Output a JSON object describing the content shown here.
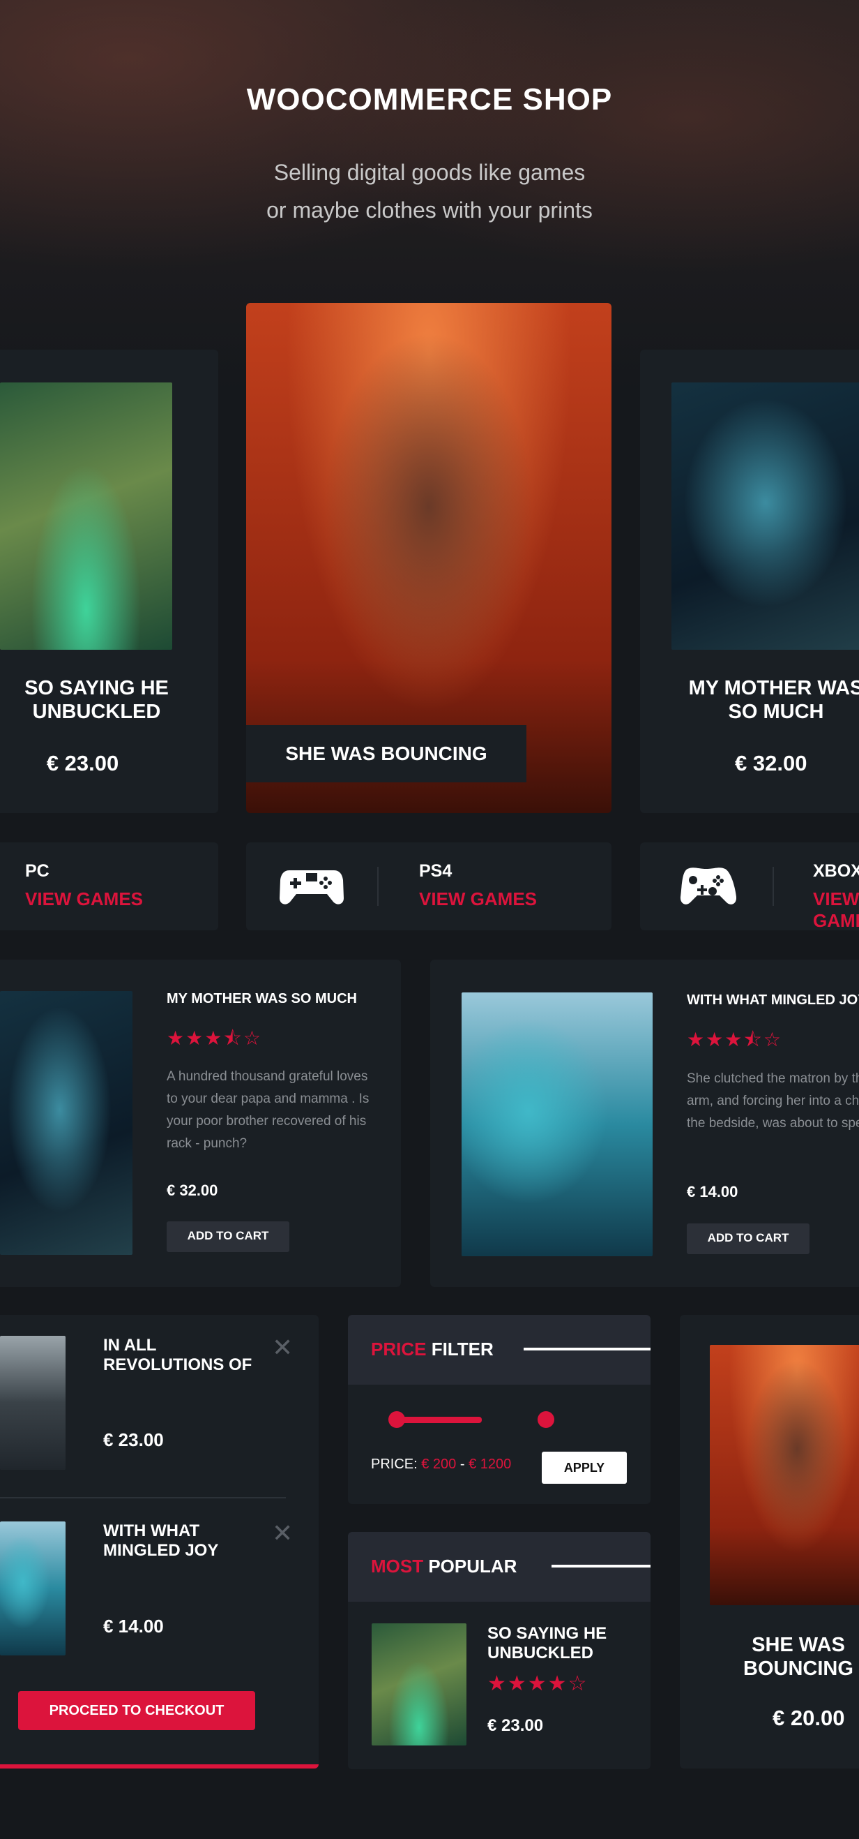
{
  "header": {
    "title": "WOOCOMMERCE SHOP",
    "subtitle_line1": "Selling digital goods like games",
    "subtitle_line2": "or maybe clothes with your prints"
  },
  "carousel": [
    {
      "title_line1": "SO SAYING HE",
      "title_line2": "UNBUCKLED",
      "price": "€ 23.00"
    },
    {
      "title": "SHE WAS BOUNCING"
    },
    {
      "title_line1": "MY MOTHER WAS",
      "title_line2": "SO MUCH",
      "price": "€ 32.00"
    }
  ],
  "platforms": [
    {
      "name": "PC",
      "link": "VIEW GAMES"
    },
    {
      "name": "PS4",
      "link": "VIEW GAMES",
      "icon": "gamepad-icon"
    },
    {
      "name": "XBOX",
      "link": "VIEW GAMES",
      "icon": "xbox-controller-icon"
    }
  ],
  "products": [
    {
      "title": "MY MOTHER WAS SO MUCH",
      "rating": 3.5,
      "stars": "★★★⯪☆",
      "description": "A hundred thousand grateful loves to your dear papa and mamma . Is your poor brother recovered of his rack - punch?",
      "price": "€ 32.00",
      "button": "ADD TO CART"
    },
    {
      "title": "WITH WHAT MINGLED JOY",
      "rating": 3.5,
      "stars": "★★★⯪☆",
      "description": "She clutched the matron by the arm, and forcing her into a chair by the bedside, was about to speak.",
      "price": "€ 14.00",
      "button": "ADD TO CART"
    }
  ],
  "cart": {
    "items": [
      {
        "title_line1": "IN ALL",
        "title_line2": "REVOLUTIONS OF",
        "price": "€ 23.00"
      },
      {
        "title_line1": "WITH WHAT",
        "title_line2": "MINGLED JOY",
        "price": "€ 14.00"
      }
    ],
    "remove": "✕",
    "checkout": "PROCEED TO CHECKOUT"
  },
  "price_filter": {
    "title_accent": "PRICE",
    "title_rest": "FILTER",
    "label": "PRICE:",
    "min": "€ 200",
    "dash": "-",
    "max": "€ 1200",
    "apply": "APPLY"
  },
  "most_popular": {
    "title_accent": "MOST",
    "title_rest": "POPULAR",
    "item": {
      "title_line1": "SO SAYING HE",
      "title_line2": "UNBUCKLED",
      "rating": 4,
      "stars": "★★★★☆",
      "price": "€ 23.00"
    }
  },
  "featured": {
    "title_line1": "SHE WAS",
    "title_line2": "BOUNCING",
    "price": "€ 20.00"
  },
  "colors": {
    "accent": "#dc143c",
    "background": "#15181c",
    "card": "#1a1f24"
  }
}
